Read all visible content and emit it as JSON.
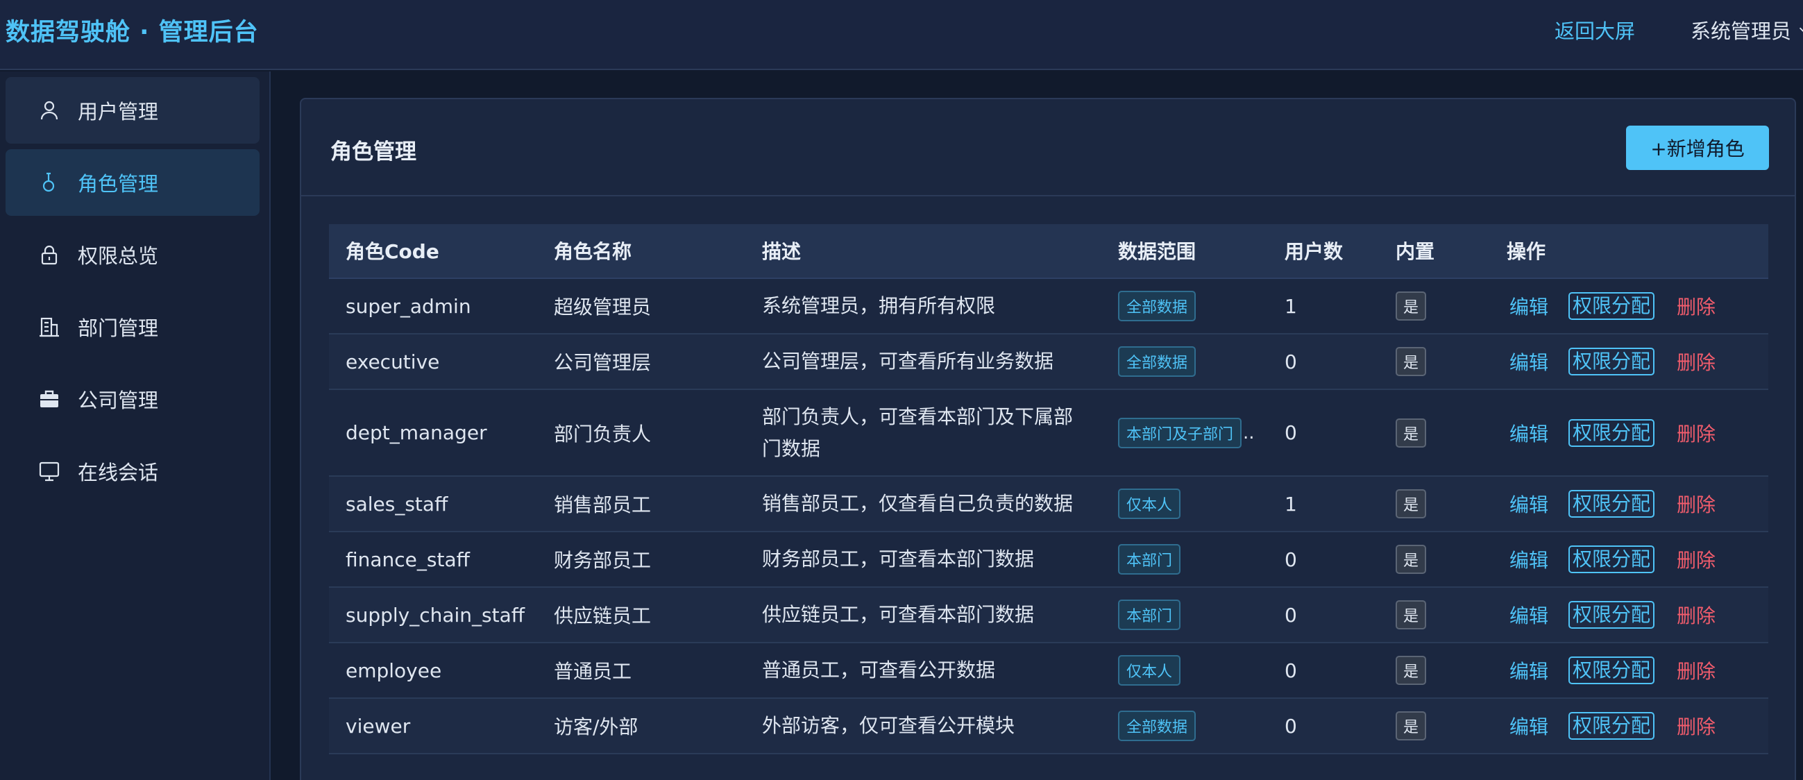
{
  "header": {
    "title": "数据驾驶舱 · 管理后台",
    "back_label": "返回大屏",
    "user_label": "系统管理员"
  },
  "sidebar": {
    "items": [
      {
        "label": "用户管理",
        "icon": "user-icon"
      },
      {
        "label": "角色管理",
        "icon": "key-icon",
        "active": true
      },
      {
        "label": "权限总览",
        "icon": "lock-icon"
      },
      {
        "label": "部门管理",
        "icon": "building-icon"
      },
      {
        "label": "公司管理",
        "icon": "briefcase-icon"
      },
      {
        "label": "在线会话",
        "icon": "monitor-icon"
      }
    ]
  },
  "main": {
    "title": "角色管理",
    "add_button": "+新增角色",
    "columns": [
      "角色Code",
      "角色名称",
      "描述",
      "数据范围",
      "用户数",
      "内置",
      "操作"
    ],
    "ops": {
      "edit": "编辑",
      "perm": "权限分配",
      "delete": "删除"
    },
    "rows": [
      {
        "code": "super_admin",
        "name": "超级管理员",
        "desc": "系统管理员，拥有所有权限",
        "scope": "全部数据",
        "users": "1",
        "builtin": "是"
      },
      {
        "code": "executive",
        "name": "公司管理层",
        "desc": "公司管理层，可查看所有业务数据",
        "scope": "全部数据",
        "users": "0",
        "builtin": "是"
      },
      {
        "code": "dept_manager",
        "name": "部门负责人",
        "desc": "部门负责人，可查看本部门及下属部门数据",
        "scope": "本部门及子部门",
        "users": "0",
        "builtin": "是"
      },
      {
        "code": "sales_staff",
        "name": "销售部员工",
        "desc": "销售部员工，仅查看自己负责的数据",
        "scope": "仅本人",
        "users": "1",
        "builtin": "是"
      },
      {
        "code": "finance_staff",
        "name": "财务部员工",
        "desc": "财务部员工，可查看本部门数据",
        "scope": "本部门",
        "users": "0",
        "builtin": "是"
      },
      {
        "code": "supply_chain_staff",
        "name": "供应链员工",
        "desc": "供应链员工，可查看本部门数据",
        "scope": "本部门",
        "users": "0",
        "builtin": "是"
      },
      {
        "code": "employee",
        "name": "普通员工",
        "desc": "普通员工，可查看公开数据",
        "scope": "仅本人",
        "users": "0",
        "builtin": "是"
      },
      {
        "code": "viewer",
        "name": "访客/外部",
        "desc": "外部访客，仅可查看公开模块",
        "scope": "全部数据",
        "users": "0",
        "builtin": "是"
      }
    ]
  },
  "colors": {
    "accent": "#4fc3f7",
    "danger": "#f05c6c",
    "background": "#111a2c"
  }
}
